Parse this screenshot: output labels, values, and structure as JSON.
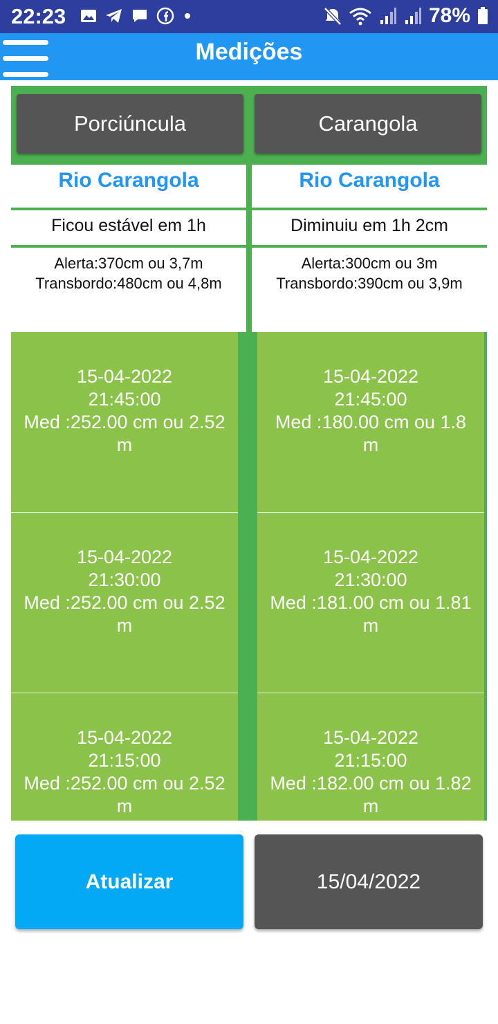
{
  "status_bar": {
    "time": "22:23",
    "battery": "78%",
    "icons_left": [
      "gallery-icon",
      "telegram-icon",
      "message-icon",
      "facebook-icon",
      "dot-icon"
    ],
    "icons_right": [
      "mute-icon",
      "wifi-icon",
      "signal-icon",
      "signal-icon",
      "battery-icon"
    ]
  },
  "app_bar": {
    "title": "Medições",
    "menu_icon": "hamburger-menu-icon",
    "color": "#2196f3"
  },
  "cities": [
    {
      "button_label": "Porciúncula",
      "river": "Rio Carangola",
      "trend": "Ficou estável em 1h",
      "alert": "Alerta:370cm ou 3,7m",
      "overflow": "Transbordo:480cm ou 4,8m",
      "measurements": [
        {
          "date": "15-04-2022",
          "time": "21:45:00",
          "value": "Med :252.00 cm ou 2.52 m"
        },
        {
          "date": "15-04-2022",
          "time": "21:30:00",
          "value": "Med :252.00 cm ou 2.52 m"
        },
        {
          "date": "15-04-2022",
          "time": "21:15:00",
          "value": "Med :252.00 cm ou 2.52 m"
        }
      ]
    },
    {
      "button_label": "Carangola",
      "river": "Rio Carangola",
      "trend": "Diminuiu em 1h 2cm",
      "alert": "Alerta:300cm ou 3m",
      "overflow": "Transbordo:390cm ou 3,9m",
      "measurements": [
        {
          "date": "15-04-2022",
          "time": "21:45:00",
          "value": "Med :180.00 cm ou 1.8 m"
        },
        {
          "date": "15-04-2022",
          "time": "21:30:00",
          "value": "Med :181.00 cm ou 1.81 m"
        },
        {
          "date": "15-04-2022",
          "time": "21:15:00",
          "value": "Med :182.00 cm ou 1.82 m"
        }
      ]
    }
  ],
  "buttons": {
    "refresh_label": "Atualizar",
    "date_label": "15/04/2022"
  },
  "colors": {
    "primary": "#2196f3",
    "status_bar": "#2d3e9e",
    "green_frame": "#4caf50",
    "cell_green": "#8bc34a",
    "dark_button": "#555555",
    "refresh_button": "#03a9f4"
  }
}
